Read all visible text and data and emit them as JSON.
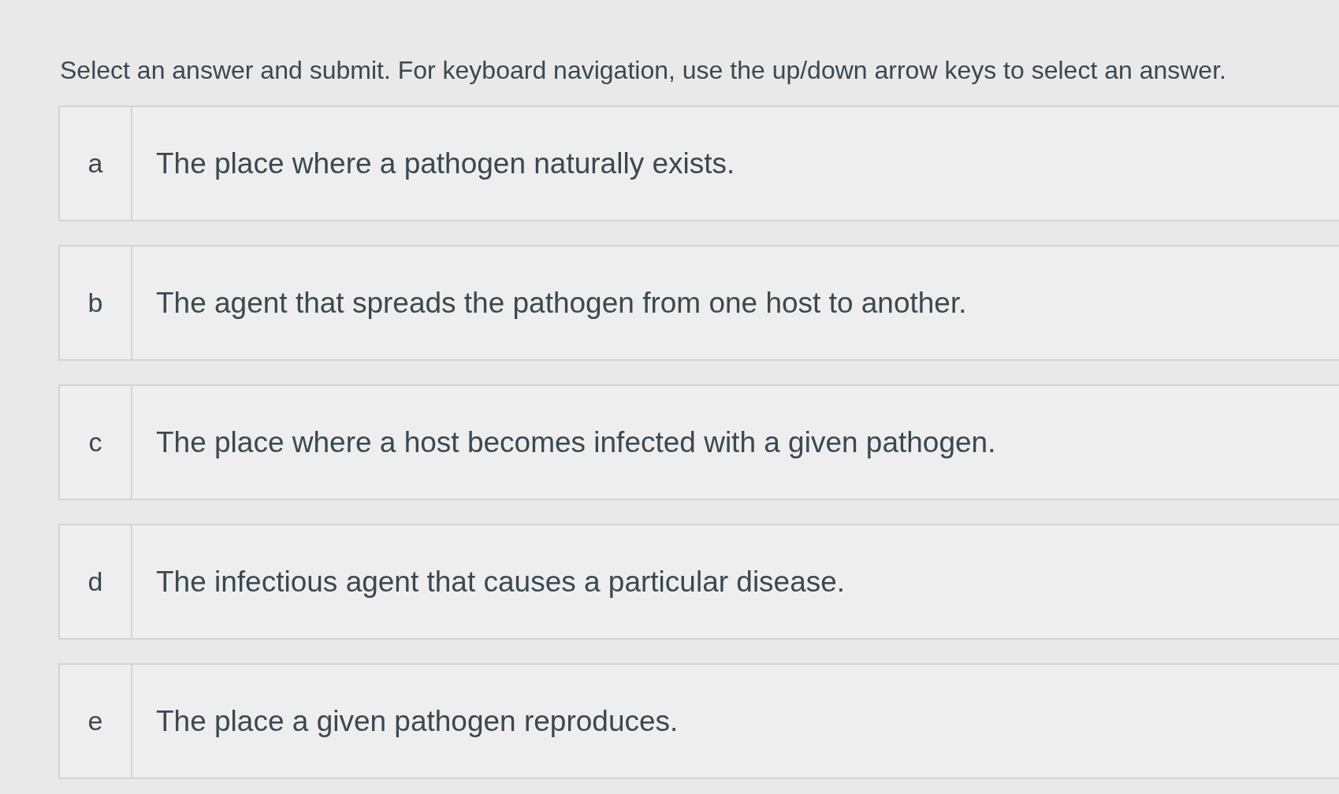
{
  "instruction": "Select an answer and submit. For keyboard navigation, use the up/down arrow keys to select an answer.",
  "options": [
    {
      "letter": "a",
      "text": "The place where a pathogen naturally exists.",
      "selected": false
    },
    {
      "letter": "b",
      "text": "The agent that spreads the pathogen from one host to another.",
      "selected": false
    },
    {
      "letter": "c",
      "text": "The place where a host becomes infected with a given pathogen.",
      "selected": false
    },
    {
      "letter": "d",
      "text": "The infectious agent that causes a particular disease.",
      "selected": false
    },
    {
      "letter": "e",
      "text": "The place a given pathogen reproduces.",
      "selected": false
    }
  ]
}
